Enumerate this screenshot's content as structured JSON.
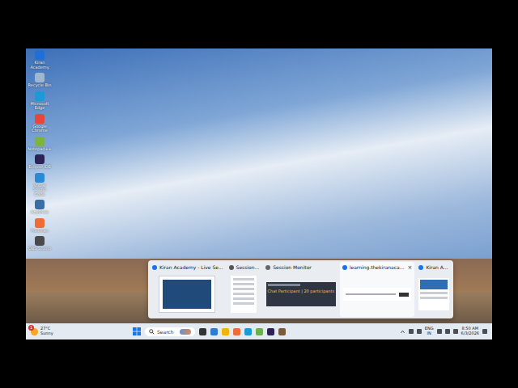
{
  "desktop_icons": [
    {
      "label": "Kiran Academy",
      "color": "#1e6fd9"
    },
    {
      "label": "Recycle Bin",
      "color": "#9fb8d0"
    },
    {
      "label": "Microsoft Edge",
      "color": "#1a9bd7"
    },
    {
      "label": "Google Chrome",
      "color": "#e8453c"
    },
    {
      "label": "Notepad++",
      "color": "#7cb342"
    },
    {
      "label": "Eclipse IDE",
      "color": "#2c2255"
    },
    {
      "label": "Visual Studio Code",
      "color": "#2a8ad4"
    },
    {
      "label": "AnyDesk",
      "color": "#3a6ea5"
    },
    {
      "label": "Postman",
      "color": "#ef6c35"
    },
    {
      "label": "OBS Studio",
      "color": "#4a4a4a"
    }
  ],
  "thumbnails": [
    {
      "title": "Kiran Academy - Live Se...",
      "kind": "video",
      "selected": false,
      "color": "#1a73e8"
    },
    {
      "title": "Session...",
      "kind": "list",
      "selected": false,
      "color": "#555555"
    },
    {
      "title": "Session Monitor",
      "kind": "monitor",
      "selected": false,
      "color": "#666666",
      "banner": "Chat Participant | 20 participants"
    },
    {
      "title": "learning.thekiranaca...",
      "kind": "page",
      "selected": true,
      "color": "#1a73e8",
      "close": "×"
    },
    {
      "title": "Kiran A...",
      "kind": "narrow",
      "selected": false,
      "color": "#1a73e8"
    }
  ],
  "taskbar": {
    "weather": {
      "badge": "1",
      "temp": "27°C",
      "condition": "Sunny"
    },
    "search": {
      "placeholder": "Search"
    },
    "apps": [
      {
        "color": "#333333"
      },
      {
        "color": "#2b7cd3"
      },
      {
        "color": "#f3b300"
      },
      {
        "color": "#ef6c35"
      },
      {
        "color": "#1a9bd7"
      },
      {
        "color": "#6ab04c"
      },
      {
        "color": "#2c2255"
      },
      {
        "color": "#7a5c3a"
      }
    ],
    "language": {
      "top": "ENG",
      "bottom": "IN"
    },
    "time": "8:50 AM",
    "date": "6/3/2026"
  }
}
